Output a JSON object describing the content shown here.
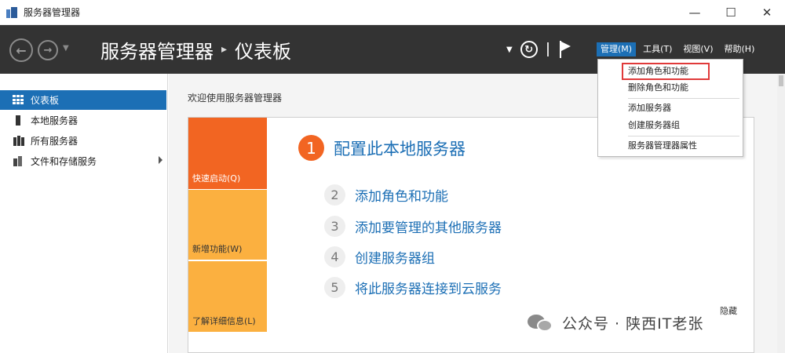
{
  "window": {
    "title": "服务器管理器",
    "controls": {
      "minimize": "—",
      "maximize": "☐",
      "close": "✕"
    }
  },
  "header": {
    "breadcrumb_root": "服务器管理器",
    "breadcrumb_sep": "▸",
    "breadcrumb_current": "仪表板",
    "menu": [
      {
        "label": "管理(M)",
        "active": true
      },
      {
        "label": "工具(T)",
        "active": false
      },
      {
        "label": "视图(V)",
        "active": false
      },
      {
        "label": "帮助(H)",
        "active": false
      }
    ]
  },
  "sidebar": {
    "items": [
      {
        "label": "仪表板",
        "icon": "dashboard-icon",
        "selected": true
      },
      {
        "label": "本地服务器",
        "icon": "local-server-icon"
      },
      {
        "label": "所有服务器",
        "icon": "all-servers-icon"
      },
      {
        "label": "文件和存储服务",
        "icon": "file-storage-icon",
        "has_submenu": true
      }
    ]
  },
  "main": {
    "welcome": "欢迎使用服务器管理器",
    "tiles": {
      "quick": "快速启动(Q)",
      "new": "新增功能(W)",
      "learn": "了解详细信息(L)"
    },
    "steps": [
      {
        "num": "1",
        "label": "配置此本地服务器"
      },
      {
        "num": "2",
        "label": "添加角色和功能"
      },
      {
        "num": "3",
        "label": "添加要管理的其他服务器"
      },
      {
        "num": "4",
        "label": "创建服务器组"
      },
      {
        "num": "5",
        "label": "将此服务器连接到云服务"
      }
    ],
    "hide": "隐藏"
  },
  "dropdown": {
    "items": [
      {
        "label": "添加角色和功能",
        "highlighted": true
      },
      {
        "label": "删除角色和功能"
      },
      {
        "label": "添加服务器"
      },
      {
        "label": "创建服务器组"
      },
      {
        "label": "服务器管理器属性"
      }
    ]
  },
  "watermark": {
    "text": "公众号 · 陕西IT老张"
  },
  "colors": {
    "header_bg": "#333333",
    "accent_blue": "#1c6fb5",
    "orange": "#f26522",
    "amber": "#fbb040",
    "highlight_red": "#e03a3a"
  }
}
